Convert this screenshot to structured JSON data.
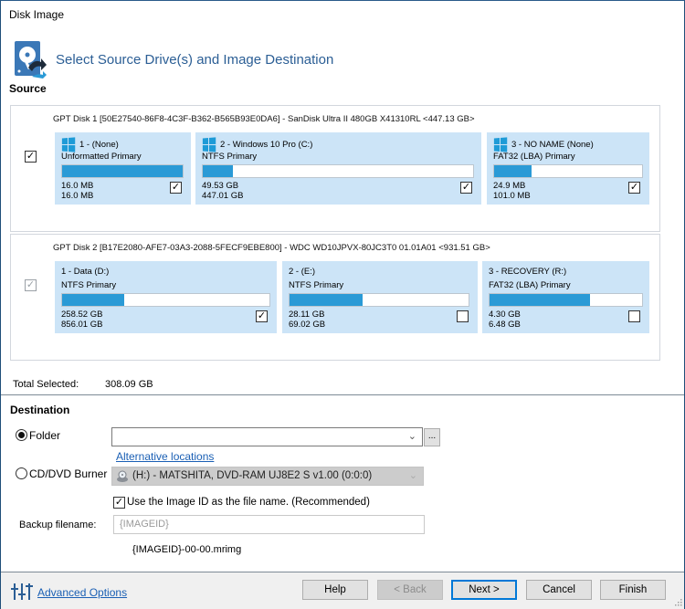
{
  "window": {
    "title": "Disk Image"
  },
  "header": {
    "title": "Select Source Drive(s) and Image Destination",
    "icon": "disk-image-icon"
  },
  "source": {
    "label": "Source",
    "disks": [
      {
        "header": "GPT Disk 1 [50E27540-86F8-4C3F-B362-B565B93E0DA6] - SanDisk Ultra II 480GB X41310RL  <447.13 GB>",
        "checked": true,
        "partial": false,
        "partitions": [
          {
            "name": "1 -  (None)",
            "fs": "Unformatted Primary",
            "used": "16.0 MB",
            "total": "16.0 MB",
            "fill_fraction": 1.0,
            "checked": true,
            "windows_icon": true
          },
          {
            "name": "2 - Windows 10 Pro (C:)",
            "fs": "NTFS Primary",
            "used": "49.53 GB",
            "total": "447.01 GB",
            "fill_fraction": 0.11,
            "checked": true,
            "windows_icon": true
          },
          {
            "name": "3 - NO NAME (None)",
            "fs": "FAT32 (LBA) Primary",
            "used": "24.9 MB",
            "total": "101.0 MB",
            "fill_fraction": 0.25,
            "checked": true,
            "windows_icon": true
          }
        ]
      },
      {
        "header": "GPT Disk 2 [B17E2080-AFE7-03A3-2088-5FECF9EBE800] - WDC WD10JPVX-80JC3T0 01.01A01  <931.51 GB>",
        "checked": true,
        "partial": true,
        "partitions": [
          {
            "name": "1 - Data (D:)",
            "fs": "NTFS Primary",
            "used": "258.52 GB",
            "total": "856.01 GB",
            "fill_fraction": 0.3,
            "checked": true,
            "windows_icon": false
          },
          {
            "name": "2 -  (E:)",
            "fs": "NTFS Primary",
            "used": "28.11 GB",
            "total": "69.02 GB",
            "fill_fraction": 0.41,
            "checked": false,
            "windows_icon": false
          },
          {
            "name": "3 - RECOVERY (R:)",
            "fs": "FAT32 (LBA) Primary",
            "used": "4.30 GB",
            "total": "6.48 GB",
            "fill_fraction": 0.66,
            "checked": false,
            "windows_icon": false
          }
        ]
      }
    ],
    "total_selected_label": "Total Selected:",
    "total_selected_value": "308.09 GB"
  },
  "destination": {
    "label": "Destination",
    "folder_option": {
      "label": "Folder",
      "selected": true,
      "value": ""
    },
    "browse_label": "...",
    "alternative_locations_link": "Alternative locations",
    "burner_option": {
      "label": "CD/DVD Burner",
      "selected": false,
      "value": "(H:) - MATSHITA, DVD-RAM UJ8E2 S  v1.00 (0:0:0)"
    },
    "use_image_id": {
      "label": "Use the Image ID as the file name.  (Recommended)",
      "checked": true
    },
    "backup_filename_label": "Backup filename:",
    "backup_filename_value": "{IMAGEID}",
    "resulting_filename": "{IMAGEID}-00-00.mrimg"
  },
  "footer": {
    "advanced_options_link": "Advanced Options",
    "buttons": {
      "help": "Help",
      "back": "< Back",
      "next": "Next >",
      "cancel": "Cancel",
      "finish": "Finish"
    }
  }
}
